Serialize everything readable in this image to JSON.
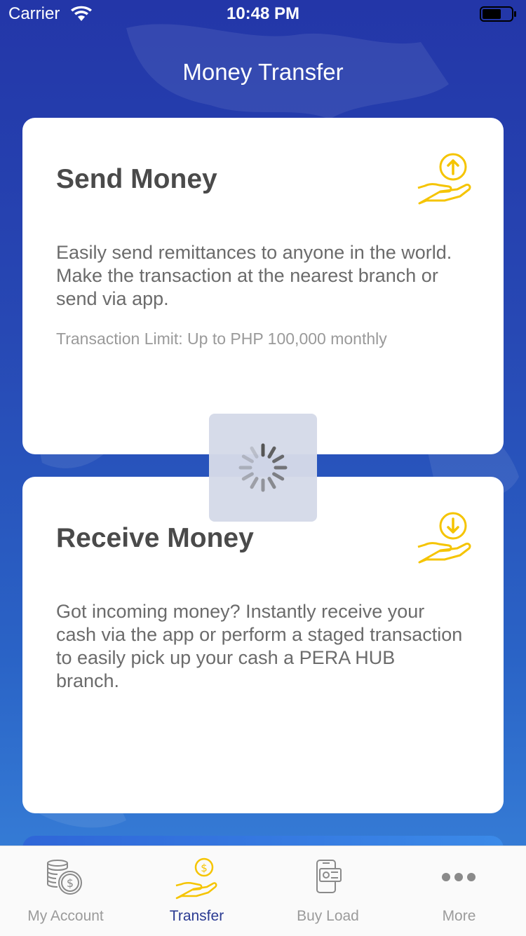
{
  "status_bar": {
    "carrier": "Carrier",
    "time": "10:48 PM"
  },
  "header": {
    "title": "Money Transfer"
  },
  "cards": {
    "send": {
      "title": "Send Money",
      "description": "Easily send remittances to anyone in the world. Make the transaction at the nearest branch or send via app.",
      "limit": "Transaction Limit: Up to PHP 100,000 monthly",
      "icon": "send-money-hand-icon"
    },
    "receive": {
      "title": "Receive Money",
      "description": "Got incoming money? Instantly receive your cash via the app or perform a staged transaction to easily pick up your cash a PERA HUB branch.",
      "icon": "receive-money-hand-icon"
    }
  },
  "loader": {
    "icon": "activity-spinner-icon"
  },
  "tab_bar": {
    "items": [
      {
        "label": "My Account",
        "icon": "coins-icon",
        "active": false
      },
      {
        "label": "Transfer",
        "icon": "hand-coin-icon",
        "active": true
      },
      {
        "label": "Buy Load",
        "icon": "phone-cash-icon",
        "active": false
      },
      {
        "label": "More",
        "icon": "more-dots-icon",
        "active": false
      }
    ]
  },
  "colors": {
    "background": "#2540ae",
    "accent_yellow": "#f5c400",
    "active_tab": "#2a3a92",
    "inactive_tab": "#9b9b9b"
  }
}
